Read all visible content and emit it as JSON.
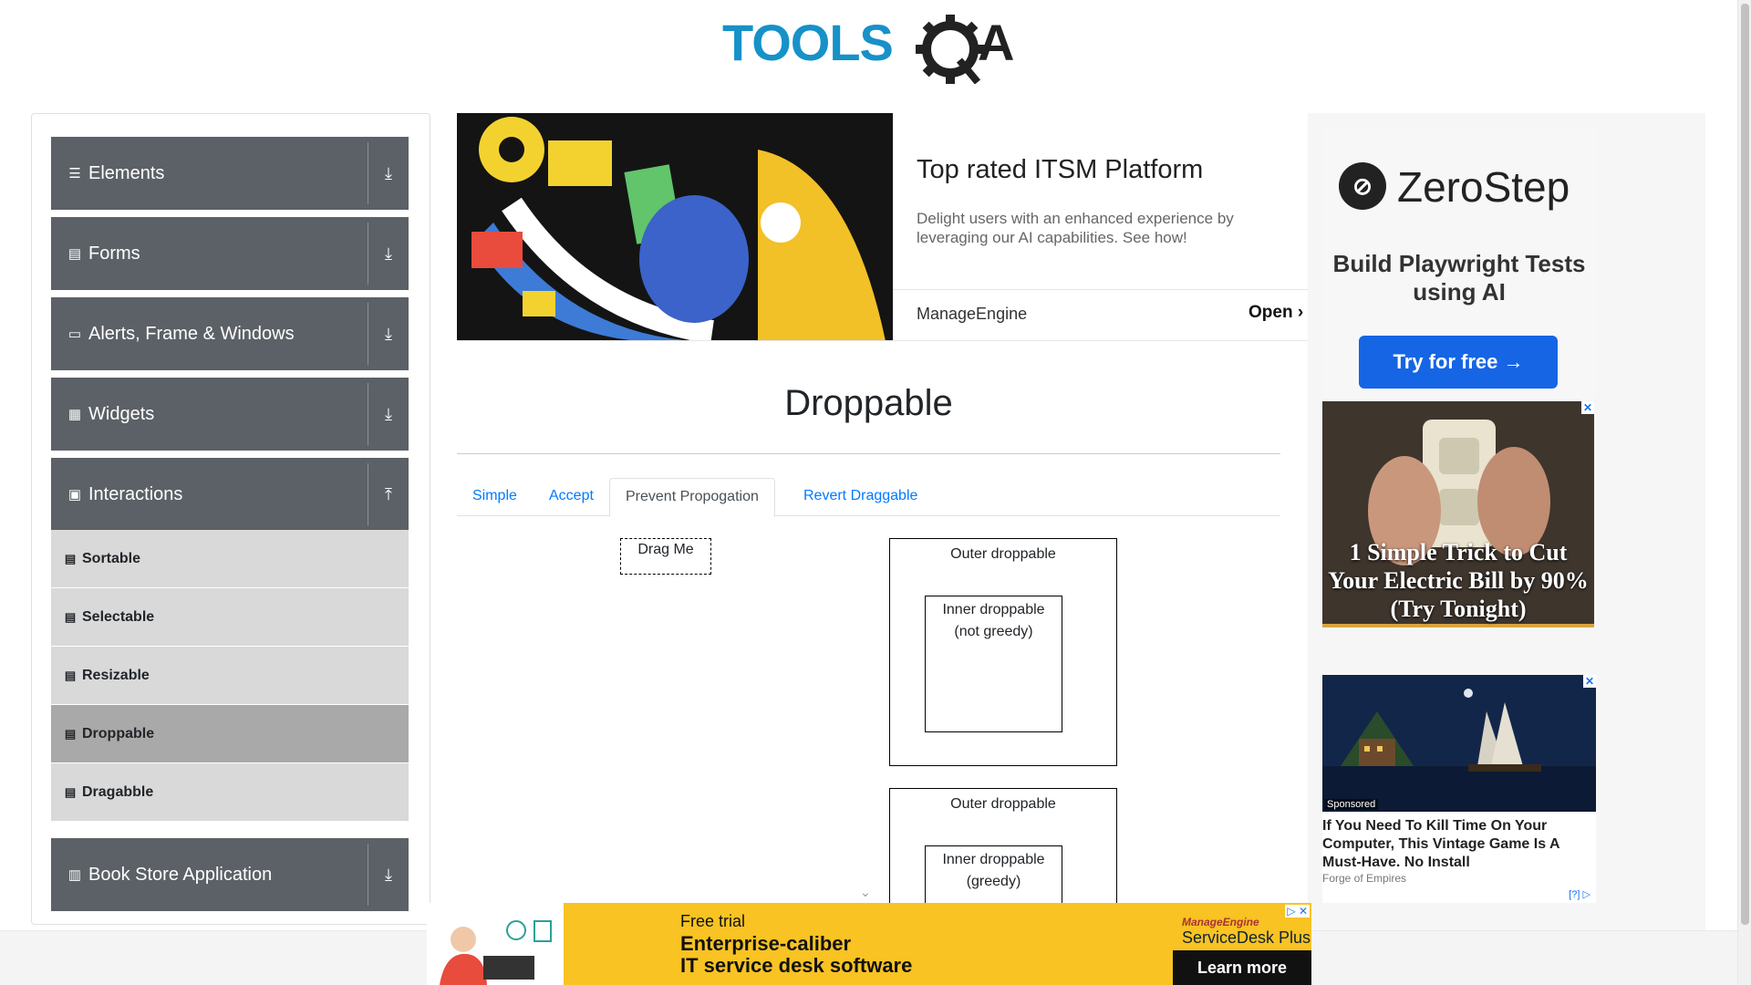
{
  "header": {
    "logo_text": "TOOLSQA"
  },
  "sidebar": {
    "groups": [
      {
        "label": "Elements",
        "icon": "menu-icon",
        "arrow": "download-arrow-icon"
      },
      {
        "label": "Forms",
        "icon": "file-icon",
        "arrow": "download-arrow-icon"
      },
      {
        "label": "Alerts, Frame & Windows",
        "icon": "window-icon",
        "arrow": "download-arrow-icon"
      },
      {
        "label": "Widgets",
        "icon": "grid-icon",
        "arrow": "download-arrow-icon"
      },
      {
        "label": "Interactions",
        "icon": "interaction-icon",
        "arrow": "upload-arrow-icon"
      },
      {
        "label": "Book Store Application",
        "icon": "books-icon",
        "arrow": "download-arrow-icon"
      }
    ],
    "sub_items": [
      {
        "label": "Sortable"
      },
      {
        "label": "Selectable"
      },
      {
        "label": "Resizable"
      },
      {
        "label": "Droppable",
        "active": true
      },
      {
        "label": "Dragabble"
      }
    ]
  },
  "top_ad": {
    "title": "Top rated ITSM Platform",
    "description": "Delight users with an enhanced experience by leveraging our AI capabilities. See how!",
    "brand": "ManageEngine",
    "cta": "Open"
  },
  "right_ads": {
    "zerostep": {
      "name": "ZeroStep",
      "tagline": "Build Playwright Tests using AI",
      "cta": "Try for free →"
    },
    "outlet": {
      "text": "1 Simple Trick to Cut Your Electric Bill by 90% (Try Tonight)",
      "close": "✕"
    },
    "game": {
      "sponsored": "Sponsored",
      "title": "If You Need To Kill Time On Your Computer, This Vintage Game Is A Must-Have. No Install",
      "source": "Forge of Empires",
      "adchoice": "[?] ▷",
      "close": "✕"
    }
  },
  "main": {
    "title": "Droppable",
    "tabs": [
      {
        "label": "Simple",
        "active": false
      },
      {
        "label": "Accept",
        "active": false
      },
      {
        "label": "Prevent Propogation",
        "active": true
      },
      {
        "label": "Revert Draggable",
        "active": false
      }
    ],
    "drag_box": "Drag Me",
    "outer_1": "Outer droppable",
    "inner_1_line1": "Inner droppable",
    "inner_1_line2": "(not greedy)",
    "outer_2": "Outer droppable",
    "inner_2_line1": "Inner droppable",
    "inner_2_line2": "(greedy)"
  },
  "bottom_ad": {
    "free_trial": "Free trial",
    "line1": "Enterprise-caliber",
    "line2": "IT service desk software",
    "brand_top": "ManageEngine",
    "brand_product": "ServiceDesk Plus",
    "cta": "Learn more",
    "close": "▷ ✕"
  },
  "colors": {
    "sidebar_group": "#5c6167",
    "sub_item": "#d9d9d9",
    "sub_item_active": "#a9a9a9",
    "tab_link": "#007bff",
    "logo_blue": "#1791c8"
  }
}
